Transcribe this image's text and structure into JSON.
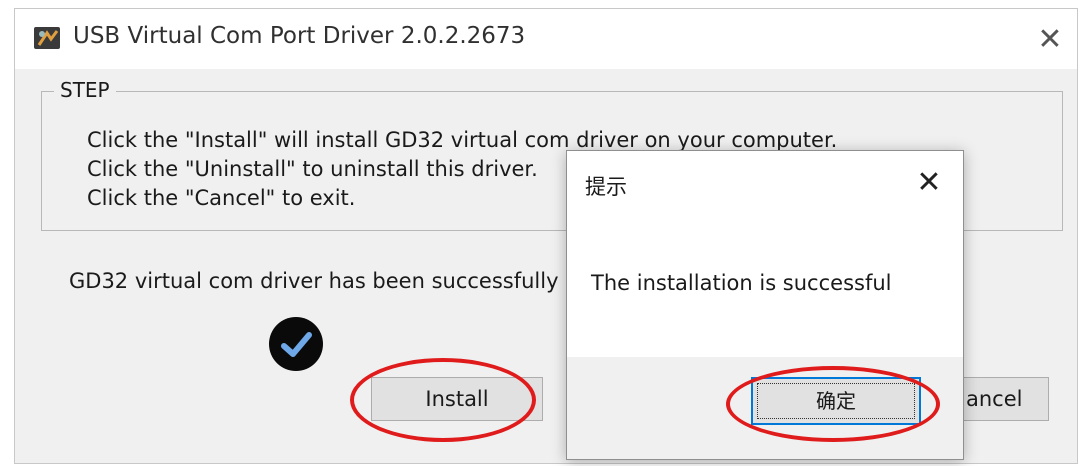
{
  "window": {
    "title": "USB Virtual Com Port Driver 2.0.2.2673",
    "icon": "driver-app-icon",
    "close_glyph": "✕"
  },
  "step_group": {
    "legend": "STEP",
    "lines": [
      "Click the \"Install\" will install GD32 virtual com driver on your computer.",
      "Click the \"Uninstall\" to uninstall this driver.",
      "Click the \"Cancel\" to exit."
    ]
  },
  "status": {
    "text": "GD32 virtual com driver has been successfully",
    "icon": "checkmark-circle-icon"
  },
  "buttons": {
    "install": "Install",
    "cancel_visible": "ancel"
  },
  "dialog": {
    "title": "提示",
    "close_glyph": "✕",
    "message": "The installation is successful",
    "ok_label": "确定"
  },
  "colors": {
    "highlight": "#e01b1b",
    "focus_border": "#0078d7",
    "window_bg": "#f0f0f0"
  }
}
